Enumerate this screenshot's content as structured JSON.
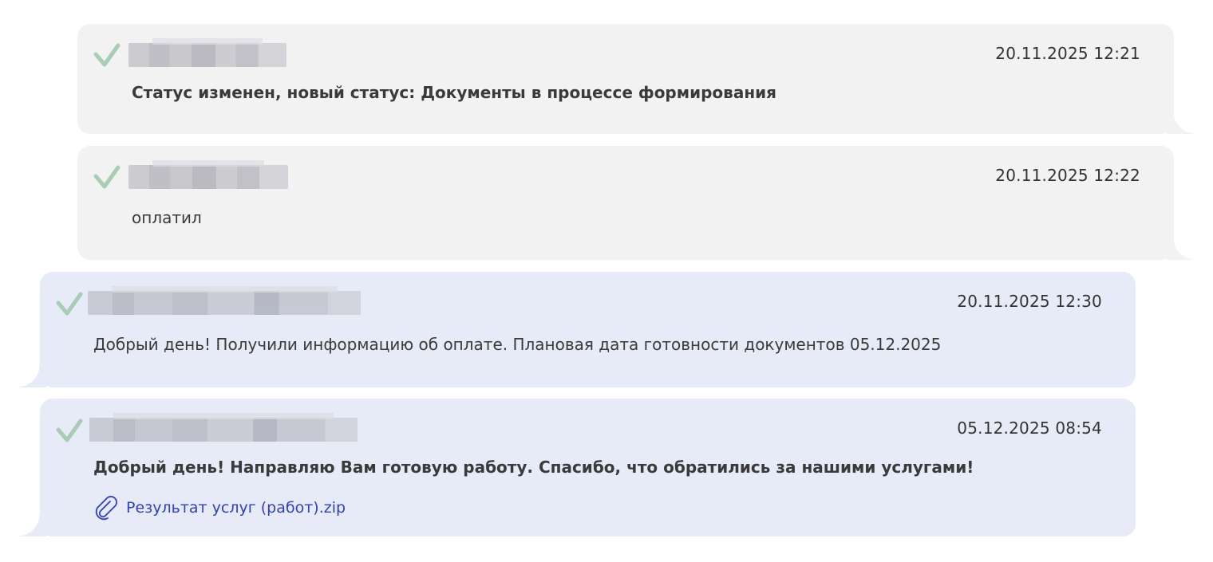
{
  "messages": [
    {
      "direction": "incoming",
      "status_icon": "check-icon",
      "time": "20.11.2025 12:21",
      "text": "Статус изменен, новый статус: Документы в процессе формирования",
      "bold": true
    },
    {
      "direction": "incoming",
      "status_icon": "check-icon",
      "time": "20.11.2025 12:22",
      "text": "оплатил",
      "bold": false
    },
    {
      "direction": "outgoing",
      "status_icon": "check-icon",
      "time": "20.11.2025 12:30",
      "text": "Добрый день! Получили информацию об оплате. Плановая дата готовности документов 05.12.2025",
      "bold": false
    },
    {
      "direction": "outgoing",
      "status_icon": "check-icon",
      "time": "05.12.2025 08:54",
      "text": "Добрый день! Направляю Вам готовую работу. Спасибо, что обратились за нашими услугами!",
      "bold": true,
      "attachment": {
        "icon": "paperclip-icon",
        "filename": "Результат услуг (работ).zip"
      }
    }
  ],
  "colors": {
    "incoming_bg": "#f2f2f2",
    "outgoing_bg": "#e6ebf7",
    "check": "#a9cdb4",
    "link": "#2f3fc7"
  }
}
